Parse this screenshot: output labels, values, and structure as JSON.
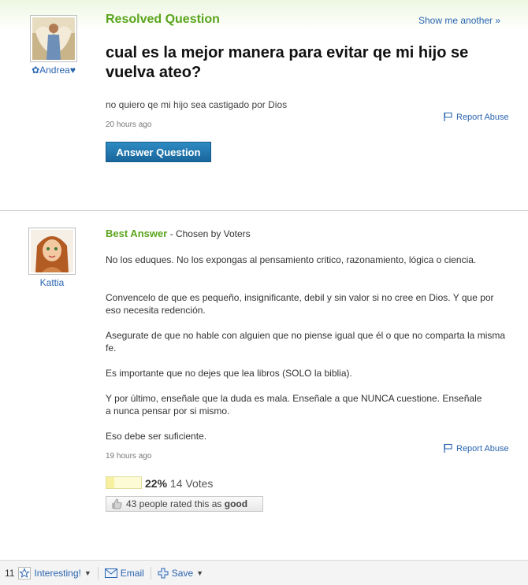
{
  "question": {
    "status_label": "Resolved Question",
    "show_another": "Show me another »",
    "asker_name": "✿Andrea♥",
    "title": "cual es la mejor manera para evitar qe mi hijo se vuelva ateo?",
    "details": "no quiero qe mi hijo sea castigado por Dios",
    "time": "20 hours ago",
    "report_abuse": "Report Abuse",
    "answer_button": "Answer Question"
  },
  "best_answer": {
    "heading": "Best Answer",
    "chosen_by": " - Chosen by Voters",
    "answerer_name": "Kattia",
    "paragraphs": [
      "No los eduques. No los expongas al pensamiento critico, razonamiento, lógica o ciencia.",
      "Convencelo de que es pequeño, insignificante, debil y sin valor si no cree en Dios. Y que por eso necesita redención.",
      "Asegurate de que no hable con alguien que no piense igual que él o que no comparta la misma fe.",
      "Es importante que no dejes que lea libros (SOLO la biblia).",
      "Y por último, enseñale que la duda es mala. Enseñale a que NUNCA cuestione. Enseñale a nunca pensar por si mismo.",
      "Eso debe ser suficiente."
    ],
    "time": "19 hours ago",
    "report_abuse": "Report Abuse",
    "vote_percent": "22%",
    "vote_fraction": 0.22,
    "votes": "14 Votes",
    "rated_prefix": "43 people rated this as ",
    "rated_word": "good"
  },
  "footer": {
    "interesting_count": "11",
    "interesting": "Interesting!",
    "email": "Email",
    "save": "Save"
  },
  "colors": {
    "green": "#5aa51c",
    "link": "#2a64b0",
    "button": "#1f74ad"
  }
}
